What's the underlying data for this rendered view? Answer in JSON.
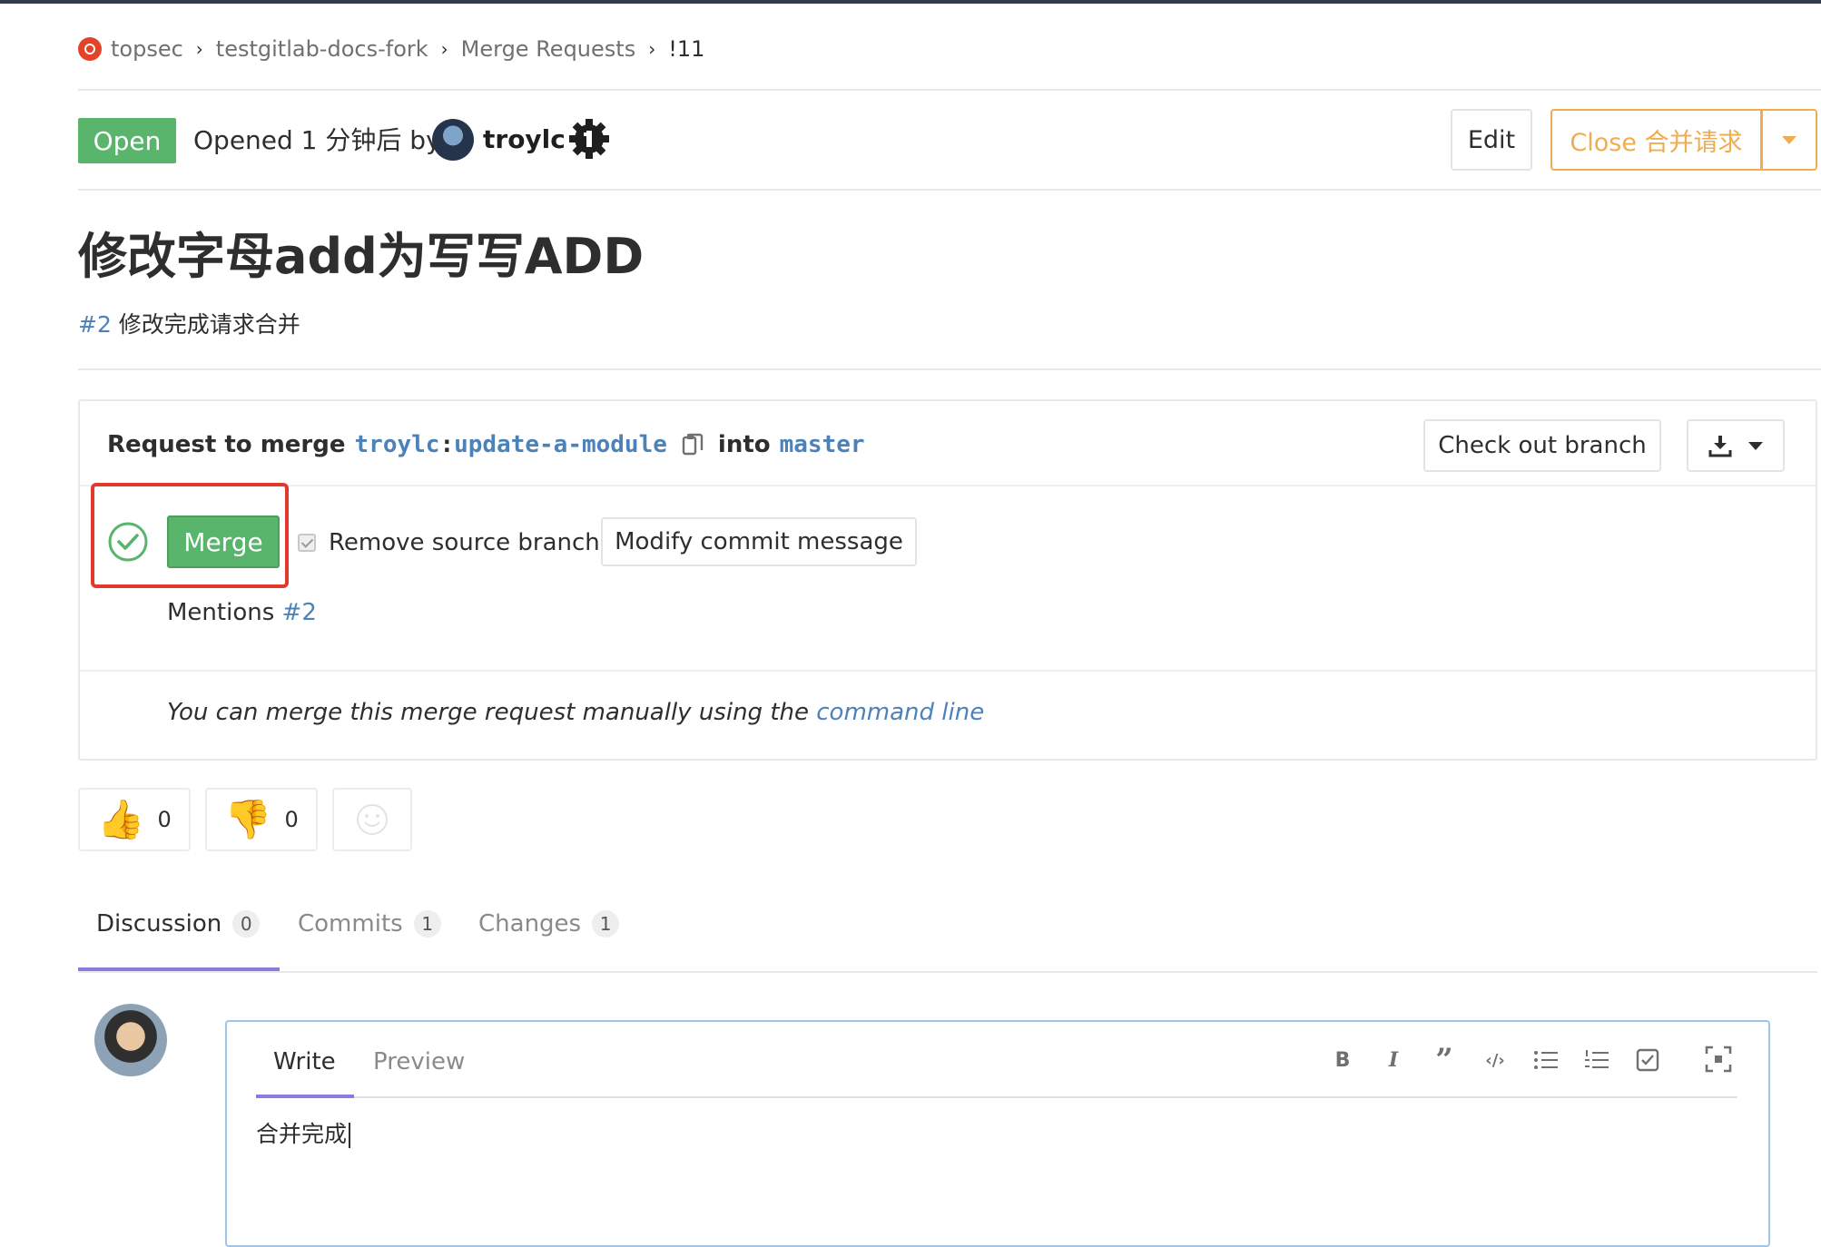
{
  "breadcrumb": {
    "items": [
      "topsec",
      "testgitlab-docs-fork",
      "Merge Requests",
      "!11"
    ]
  },
  "header": {
    "status": "Open",
    "opened_text": "Opened 1 分钟后 by",
    "author": "troylc",
    "edit_label": "Edit",
    "close_label": "Close 合并请求"
  },
  "title": "修改字母add为写写ADD",
  "description": {
    "issue_ref": "#2",
    "text": " 修改完成请求合并"
  },
  "merge_widget": {
    "request_prefix": "Request to merge",
    "source_user": "troylc",
    "source_colon": ":",
    "source_branch": "update-a-module",
    "into": "into",
    "target_branch": "master",
    "checkout_label": "Check out branch",
    "merge_label": "Merge",
    "remove_source_label": "Remove source branch",
    "modify_commit_label": "Modify commit message",
    "mentions_label": "Mentions",
    "mentions_ref": "#2",
    "manual_text": "You can merge this merge request manually using the",
    "manual_link": "command line"
  },
  "awards": {
    "thumbs_up_count": "0",
    "thumbs_down_count": "0"
  },
  "tabs": [
    {
      "label": "Discussion",
      "count": "0"
    },
    {
      "label": "Commits",
      "count": "1"
    },
    {
      "label": "Changes",
      "count": "1"
    }
  ],
  "comment": {
    "write_tab": "Write",
    "preview_tab": "Preview",
    "text": "合并完成",
    "toolbar_icons": [
      "bold-icon",
      "italic-icon",
      "quote-icon",
      "code-icon",
      "bullet-list-icon",
      "numbered-list-icon",
      "task-list-icon",
      "fullscreen-icon"
    ]
  },
  "colors": {
    "success": "#59b46c",
    "warning": "#f0ad4e",
    "link": "#4d82b8",
    "highlight": "#e2392c",
    "tab_active": "#6b5bd6"
  }
}
